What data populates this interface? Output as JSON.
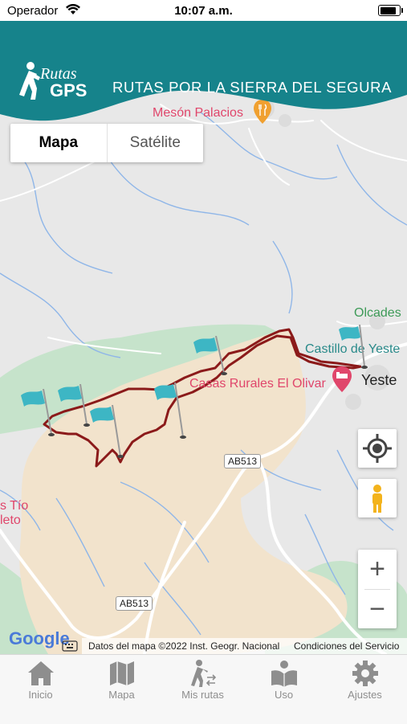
{
  "status": {
    "carrier": "Operador",
    "time": "10:07 a.m."
  },
  "header": {
    "logo_text": "RUTAS GPS",
    "title": "RUTAS POR LA SIERRA DEL SEGURA",
    "color": "#16838b"
  },
  "map_type": {
    "map_label": "Mapa",
    "satellite_label": "Satélite",
    "selected": "Mapa"
  },
  "places": {
    "meson": "Mesón Palacios",
    "olcades": "Olcades",
    "castillo": "Castillo de Yeste",
    "casas": "Casas Rurales El Olivar",
    "yeste": "Yeste",
    "tio_line1": "s Tío",
    "tio_line2": "leto"
  },
  "roads": {
    "ab513_a": "AB513",
    "ab513_b": "AB513"
  },
  "controls": {
    "zoom_in": "+",
    "zoom_out": "−"
  },
  "attribution": {
    "google": "Google",
    "data": "Datos del mapa ©2022 Inst. Geogr. Nacional",
    "terms": "Condiciones del Servicio"
  },
  "tabs": [
    {
      "label": "Inicio",
      "icon": "home-icon"
    },
    {
      "label": "Mapa",
      "icon": "map-icon"
    },
    {
      "label": "Mis rutas",
      "icon": "hiker-icon"
    },
    {
      "label": "Uso",
      "icon": "book-icon"
    },
    {
      "label": "Ajustes",
      "icon": "gear-icon"
    }
  ],
  "colors": {
    "route": "#8b1a1a",
    "flag": "#3db6c4",
    "poi_pink": "#e0466b",
    "poi_orange": "#f0a030",
    "teal_label": "#2a8a8a",
    "green_label": "#3d9a57"
  }
}
